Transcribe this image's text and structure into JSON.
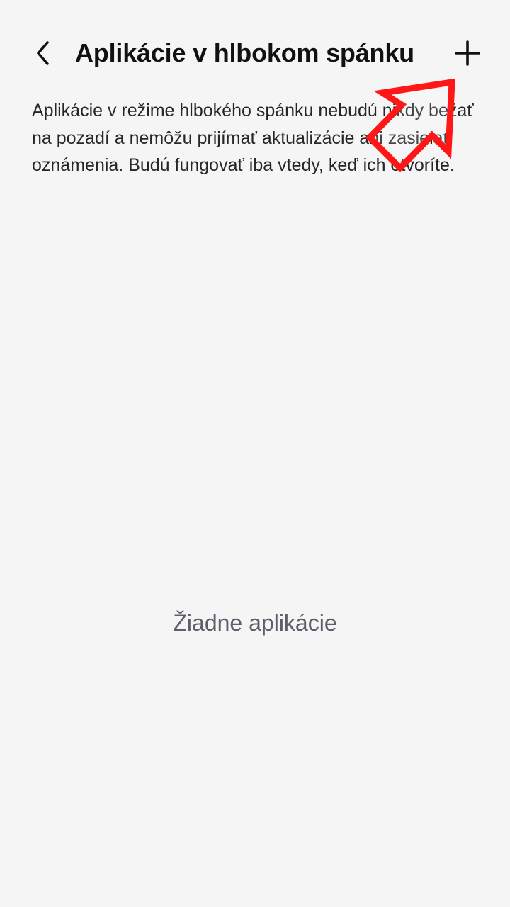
{
  "header": {
    "title": "Aplikácie v hlbokom spánku"
  },
  "description": {
    "text": "Aplikácie v režime hlbokého spánku nebudú nikdy bežať na pozadí a nemôžu prijímať aktualizácie ani zasielať oznámenia. Budú fungovať iba vtedy, keď ich otvoríte."
  },
  "empty_state": {
    "text": "Žiadne aplikácie"
  },
  "icons": {
    "back": "chevron-left-icon",
    "add": "plus-icon",
    "annotation": "arrow-up-right-icon"
  },
  "colors": {
    "background": "#f5f5f5",
    "title": "#111111",
    "body_text": "#262626",
    "empty_text": "#5b5f67",
    "annotation": "#ff1616"
  }
}
